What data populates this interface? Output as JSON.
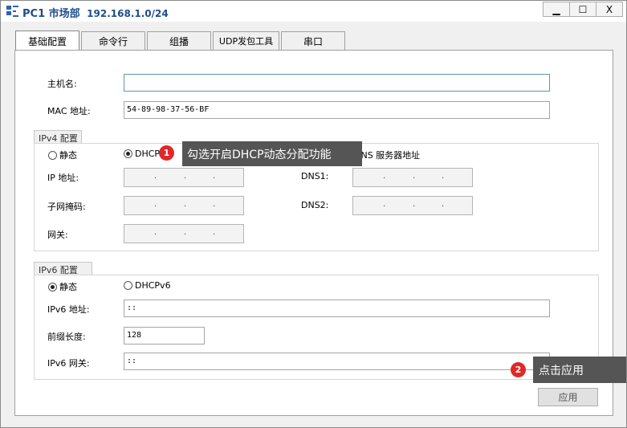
{
  "window": {
    "title": "PC1 市场部",
    "ip": "192.168.1.0/24",
    "buttons": [
      "▁",
      "☐",
      "X"
    ]
  },
  "tabs": [
    {
      "label": "基础配置",
      "active": true
    },
    {
      "label": "命令行",
      "active": false
    },
    {
      "label": "组播",
      "active": false
    },
    {
      "label": "UDP发包工具",
      "active": false
    },
    {
      "label": "串口",
      "active": false
    }
  ],
  "basic": {
    "hostname_label": "主机名:",
    "hostname_value": "",
    "mac_label": "MAC 地址:",
    "mac_value": "54-89-98-37-56-BF"
  },
  "ipv4": {
    "group_title": "IPv4 配置",
    "static_label": "静态",
    "dhcp_label": "DHCP",
    "dns_auto_label": "DNS 服务器地址",
    "ip_label": "IP 地址:",
    "mask_label": "子网掩码:",
    "gateway_label": "网关:",
    "dns1_label": "DNS1:",
    "dns2_label": "DNS2:",
    "ip_dots": [
      ".",
      ".",
      "."
    ],
    "selected": "dhcp"
  },
  "ipv6": {
    "group_title": "IPv6 配置",
    "static_label": "静态",
    "dhcp_label": "DHCPv6",
    "addr_label": "IPv6 地址:",
    "addr_value": "::",
    "prefix_label": "前缀长度:",
    "prefix_value": "128",
    "gw_label": "IPv6 网关:",
    "gw_value": "::",
    "selected": "static"
  },
  "apply_label": "应用",
  "annotations": [
    {
      "num": "1",
      "text": "勾选开启DHCP动态分配功能"
    },
    {
      "num": "2",
      "text": "点击应用"
    }
  ],
  "colors": {
    "title": "#1e4e8c",
    "badge": "#e02828",
    "tip": "#555555"
  }
}
